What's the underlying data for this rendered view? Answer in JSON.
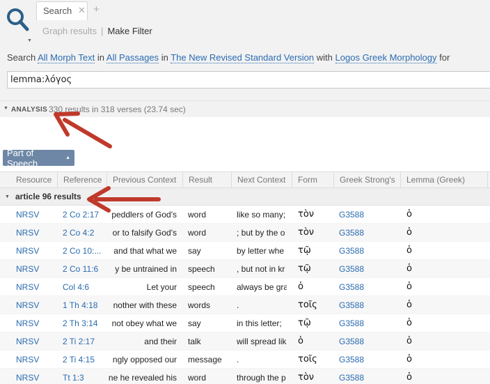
{
  "tab": {
    "label": "Search",
    "close": "✕",
    "add": "+"
  },
  "subnav": {
    "graph": "Graph results",
    "separator": "|",
    "filter": "Make Filter"
  },
  "query": {
    "prefix": "Search",
    "target": "All Morph Text",
    "in1": "in",
    "range": "All Passages",
    "in2": "in",
    "version": "The New Revised Standard Version",
    "with": "with",
    "morphology": "Logos Greek Morphology",
    "for": "for",
    "value": "lemma:λόγος"
  },
  "analysis": {
    "label": "ANALYSIS",
    "summary": "330 results in 318 verses (23.74 sec)"
  },
  "pos_button": {
    "label": "Part of Speech"
  },
  "columns": [
    "Resource",
    "Reference",
    "Previous Context",
    "Result",
    "Next Context",
    "Form",
    "Greek Strong's",
    "Lemma (Greek)"
  ],
  "group": {
    "label": "article 96 results"
  },
  "rows": [
    {
      "resource": "NRSV",
      "reference": "2 Co 2:17",
      "prev": "peddlers of God's",
      "result": "word",
      "next": "like so many;",
      "form": "τὸν",
      "strong": "G3588",
      "lemma": "ὁ"
    },
    {
      "resource": "NRSV",
      "reference": "2 Co 4:2",
      "prev": "or to falsify God's",
      "result": "word",
      "next": "; but by the o",
      "form": "τὸν",
      "strong": "G3588",
      "lemma": "ὁ"
    },
    {
      "resource": "NRSV",
      "reference": "2 Co 10:...",
      "prev": "and that what we",
      "result": "say",
      "next": "by letter whe",
      "form": "τῷ",
      "strong": "G3588",
      "lemma": "ὁ"
    },
    {
      "resource": "NRSV",
      "reference": "2 Co 11:6",
      "prev": "y be untrained in",
      "result": "speech",
      "next": ", but not in kr",
      "form": "τῷ",
      "strong": "G3588",
      "lemma": "ὁ"
    },
    {
      "resource": "NRSV",
      "reference": "Col 4:6",
      "prev": "Let your",
      "result": "speech",
      "next": "always be gra",
      "form": "ὁ",
      "strong": "G3588",
      "lemma": "ὁ"
    },
    {
      "resource": "NRSV",
      "reference": "1 Th 4:18",
      "prev": "nother with these",
      "result": "words",
      "next": ".",
      "form": "τοῖς",
      "strong": "G3588",
      "lemma": "ὁ"
    },
    {
      "resource": "NRSV",
      "reference": "2 Th 3:14",
      "prev": "not obey what we",
      "result": "say",
      "next": "in this letter;",
      "form": "τῷ",
      "strong": "G3588",
      "lemma": "ὁ"
    },
    {
      "resource": "NRSV",
      "reference": "2 Ti 2:17",
      "prev": "and their",
      "result": "talk",
      "next": "will spread lik",
      "form": "ὁ",
      "strong": "G3588",
      "lemma": "ὁ"
    },
    {
      "resource": "NRSV",
      "reference": "2 Ti 4:15",
      "prev": "ngly opposed our",
      "result": "message",
      "next": ".",
      "form": "τοῖς",
      "strong": "G3588",
      "lemma": "ὁ"
    },
    {
      "resource": "NRSV",
      "reference": "Tt 1:3",
      "prev": "ne he revealed his",
      "result": "word",
      "next": "through the p",
      "form": "τὸν",
      "strong": "G3588",
      "lemma": "ὁ"
    }
  ],
  "colors": {
    "link": "#2a6bb0",
    "button": "#6e87a6",
    "annotation_arrow": "#c0392b"
  }
}
